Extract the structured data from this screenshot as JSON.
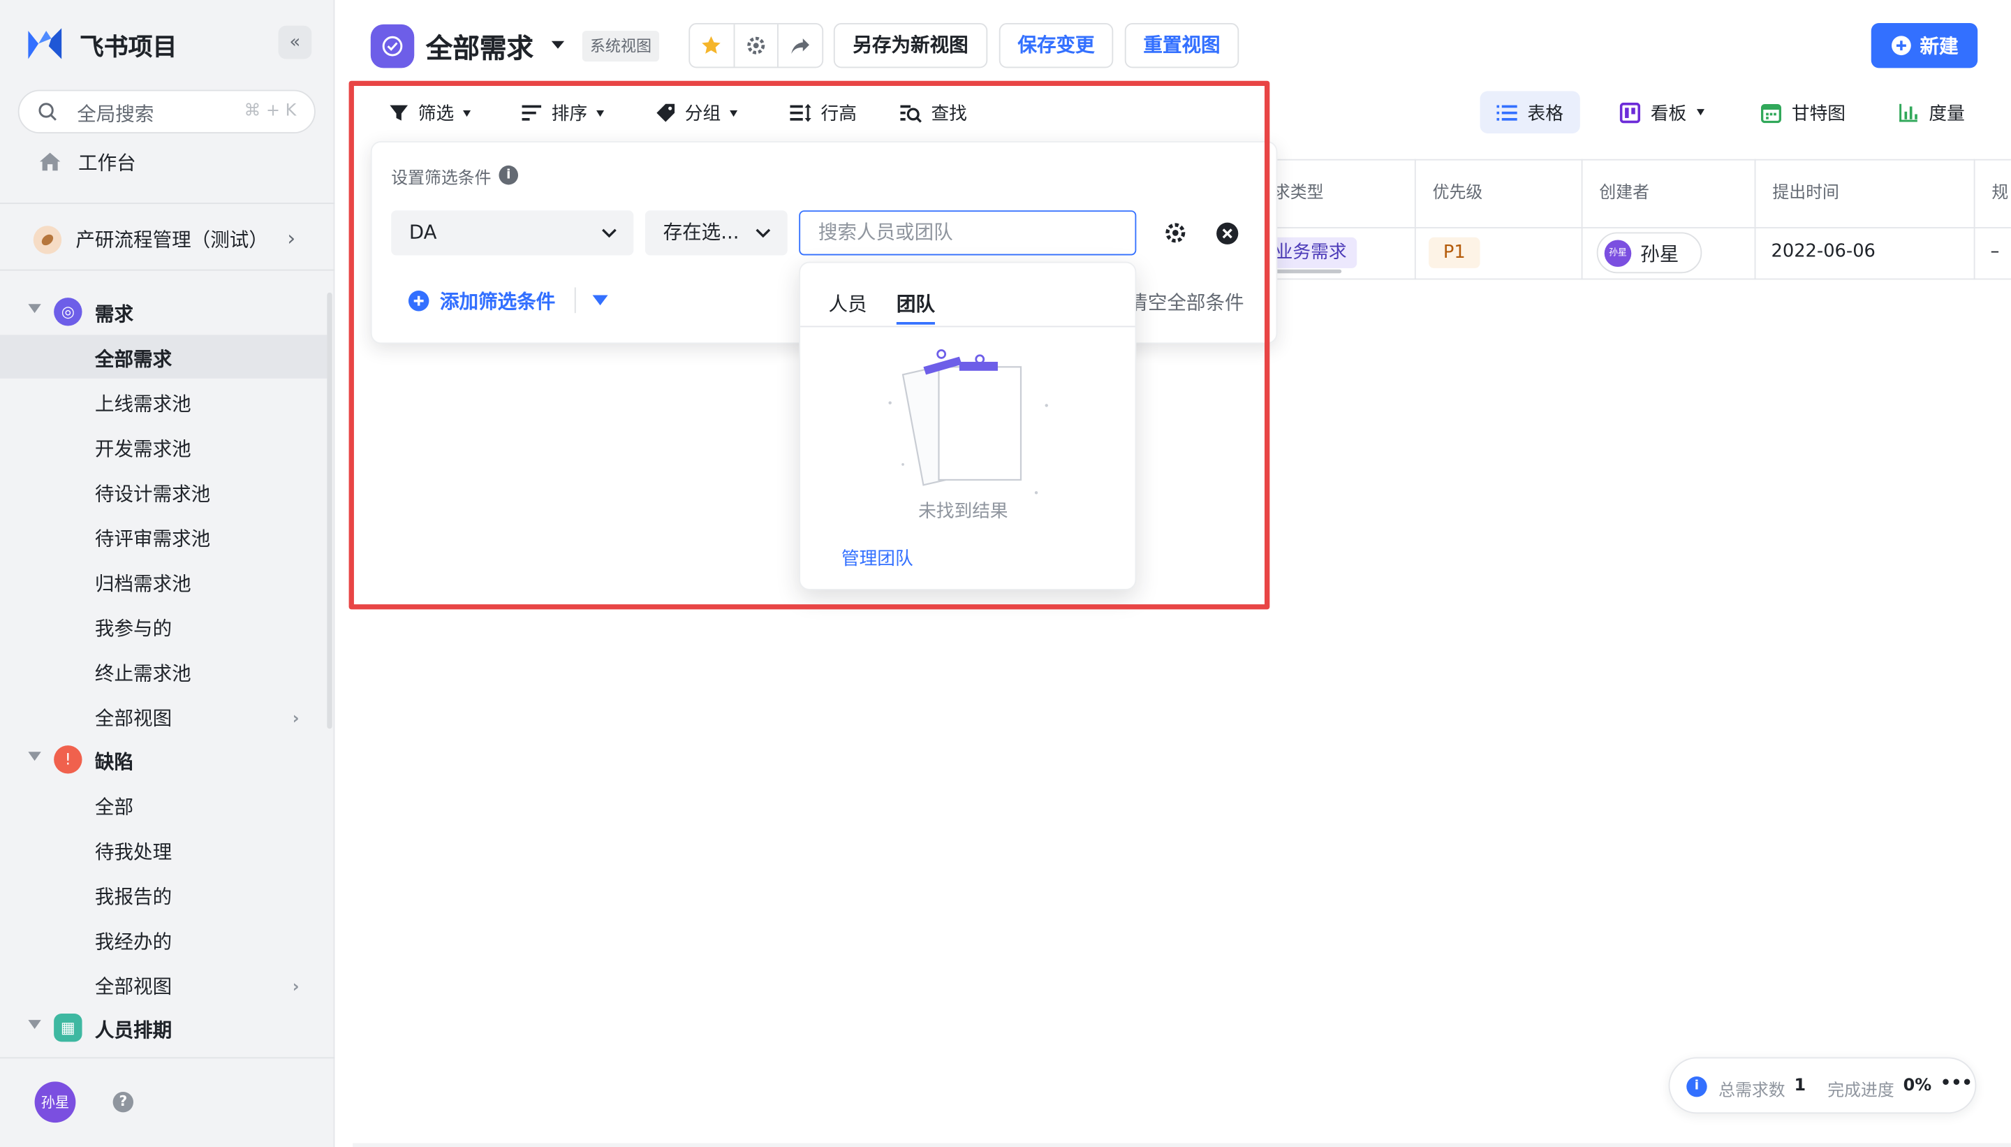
{
  "app": {
    "name": "飞书项目",
    "collapse_glyph": "«"
  },
  "search": {
    "placeholder": "全局搜索",
    "shortcut": "⌘ + K"
  },
  "nav": {
    "workbench": "工作台"
  },
  "project": {
    "name": "产研流程管理（测试）"
  },
  "sidebar": {
    "groups": [
      {
        "label": "需求",
        "color": "#6d5ee8",
        "items": [
          "全部需求",
          "上线需求池",
          "开发需求池",
          "待设计需求池",
          "待评审需求池",
          "归档需求池",
          "我参与的",
          "终止需求池",
          "全部视图"
        ]
      },
      {
        "label": "缺陷",
        "color": "#f0614d",
        "items": [
          "全部",
          "待我处理",
          "我报告的",
          "我经办的",
          "全部视图"
        ]
      },
      {
        "label": "人员排期",
        "color": "#3eb8a1",
        "items": []
      }
    ],
    "active_item": "全部需求",
    "user_avatar_text": "孙星",
    "help_glyph": "?"
  },
  "header": {
    "title": "全部需求",
    "badge": "系统视图",
    "save_as_label": "另存为新视图",
    "save_label": "保存变更",
    "reset_label": "重置视图",
    "new_label": "新建"
  },
  "toolbar": {
    "filter": "筛选",
    "sort": "排序",
    "group": "分组",
    "row_height": "行高",
    "find": "查找"
  },
  "view_tabs": [
    {
      "label": "表格",
      "active": true
    },
    {
      "label": "看板",
      "active": false
    },
    {
      "label": "甘特图",
      "active": false
    },
    {
      "label": "度量",
      "active": false
    }
  ],
  "table": {
    "columns": [
      "求类型",
      "优先级",
      "创建者",
      "提出时间",
      "规"
    ],
    "row": {
      "type": "业务需求",
      "priority": "P1",
      "creator": "孙星",
      "creator_avatar": "孙星",
      "date": "2022-06-06",
      "extra": "–"
    }
  },
  "filter_panel": {
    "title": "设置筛选条件",
    "field_value": "DA",
    "operator_value": "存在选...",
    "input_placeholder": "搜索人员或团队",
    "add_label": "添加筛选条件",
    "clear_label": "清空全部条件"
  },
  "dropdown": {
    "tabs": [
      "人员",
      "团队"
    ],
    "active_tab": "团队",
    "empty_text": "未找到结果",
    "manage_link": "管理团队"
  },
  "status_bar": {
    "total_label": "总需求数",
    "total_value": "1",
    "progress_label": "完成进度",
    "progress_value": "0%",
    "more_glyph": "•••"
  },
  "colors": {
    "accent": "#3370ff",
    "highlight_box": "#e84545",
    "purple": "#6d5ee8"
  }
}
